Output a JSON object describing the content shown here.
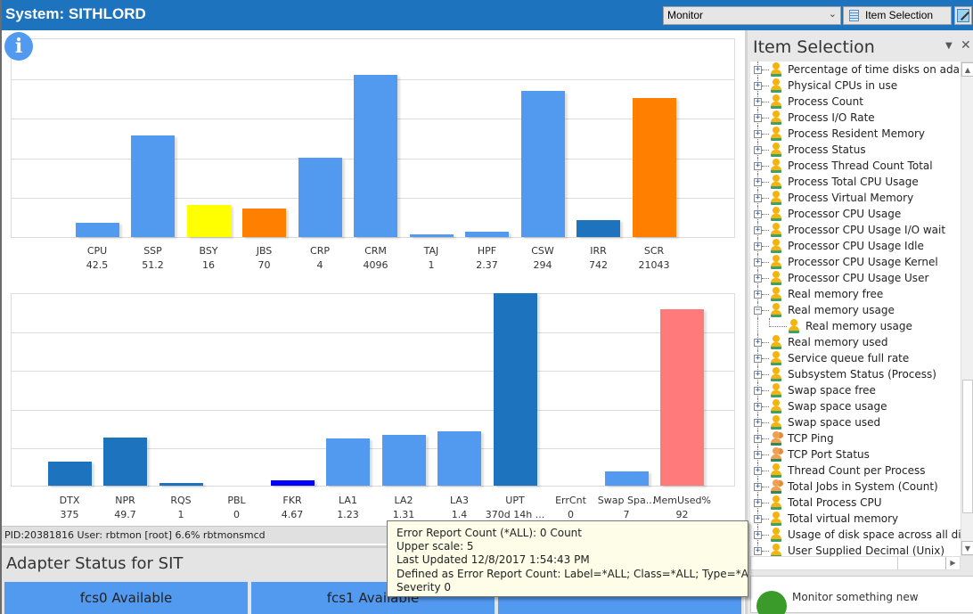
{
  "window": {
    "title": "System: SITHLORD",
    "monitor_select": "Monitor",
    "item_selection_button": "Item Selection"
  },
  "colors": {
    "titlebar": "#1e73be",
    "bar_light_blue": "#5299f0",
    "bar_dark_blue": "#1e73be",
    "bar_yellow": "#ffff00",
    "bar_orange": "#ff8000",
    "bar_blue": "#0000ff",
    "bar_salmon": "#ff7b7b"
  },
  "chart_data": [
    {
      "type": "bar",
      "title": "",
      "ylim": [
        0,
        1
      ],
      "grid": true,
      "categories": [
        "CPU",
        "SSP",
        "BSY",
        "JBS",
        "CRP",
        "CRM",
        "TAJ",
        "HPF",
        "CSW",
        "IRR",
        "SCR"
      ],
      "value_labels": [
        "42.5",
        "51.2",
        "16",
        "70",
        "4",
        "4096",
        "1",
        "2.37",
        "294",
        "742",
        "21043"
      ],
      "values_fraction_of_scale": [
        0.072,
        0.511,
        0.161,
        0.143,
        0.4,
        0.816,
        0.013,
        0.027,
        0.735,
        0.085,
        0.7
      ],
      "bar_colors": [
        "#5299f0",
        "#5299f0",
        "#ffff00",
        "#ff8000",
        "#5299f0",
        "#5299f0",
        "#5299f0",
        "#5299f0",
        "#5299f0",
        "#1e73be",
        "#ff8000"
      ]
    },
    {
      "type": "bar",
      "title": "",
      "ylim": [
        0,
        1
      ],
      "grid": true,
      "categories": [
        "DTX",
        "NPR",
        "RQS",
        "PBL",
        "FKR",
        "LA1",
        "LA2",
        "LA3",
        "UPT",
        "ErrCnt",
        "Swap Spa...",
        "MemUsed%"
      ],
      "value_labels": [
        "375",
        "49.7",
        "1",
        "0",
        "4.67",
        "1.23",
        "1.31",
        "1.4",
        "370d 14h ...",
        "0",
        "7",
        "92"
      ],
      "values_fraction_of_scale": [
        0.125,
        0.25,
        0.014,
        0.0,
        0.028,
        0.245,
        0.264,
        0.282,
        1.0,
        0.0,
        0.074,
        0.917
      ],
      "bar_colors": [
        "#1e73be",
        "#1e73be",
        "#1e73be",
        "#1e73be",
        "#0000ff",
        "#5299f0",
        "#5299f0",
        "#5299f0",
        "#1e73be",
        "#1e73be",
        "#5299f0",
        "#ff7b7b"
      ]
    }
  ],
  "status_line": "PID:20381816 User: rbtmon [root] 6.6% rbtmonsmcd",
  "adapter": {
    "title": "Adapter Status for SIT",
    "tiles": [
      "fcs0 Available",
      "fcs1 Available",
      ""
    ]
  },
  "tooltip": {
    "lines": [
      "Error Report Count (*ALL): 0 Count",
      "Upper scale: 5",
      "Last Updated 12/8/2017 1:54:43 PM",
      "Defined as Error Report Count: Label=*ALL; Class=*ALL; Type=*ALL; Resource Name=*ALL",
      "Severity 0"
    ]
  },
  "side_panel": {
    "title": "Item Selection",
    "items": [
      {
        "label": "Percentage of time disks on adapter",
        "icon": "user-icon"
      },
      {
        "label": "Physical CPUs in use",
        "icon": "user-icon"
      },
      {
        "label": "Process Count",
        "icon": "user-icon"
      },
      {
        "label": "Process I/O Rate",
        "icon": "user-icon"
      },
      {
        "label": "Process Resident Memory",
        "icon": "user-icon"
      },
      {
        "label": "Process Status",
        "icon": "user-icon"
      },
      {
        "label": "Process Thread Count Total",
        "icon": "user-icon"
      },
      {
        "label": "Process Total CPU Usage",
        "icon": "user-icon"
      },
      {
        "label": "Process Virtual Memory",
        "icon": "user-icon"
      },
      {
        "label": "Processor CPU Usage",
        "icon": "user-icon"
      },
      {
        "label": "Processor CPU Usage I/O wait",
        "icon": "user-icon"
      },
      {
        "label": "Processor CPU Usage Idle",
        "icon": "user-icon"
      },
      {
        "label": "Processor CPU Usage Kernel",
        "icon": "user-icon"
      },
      {
        "label": "Processor CPU Usage User",
        "icon": "user-icon"
      },
      {
        "label": "Real memory free",
        "icon": "user-icon"
      },
      {
        "label": "Real memory usage",
        "icon": "user-icon",
        "expanded": true
      },
      {
        "label": "Real memory usage",
        "icon": "user-icon",
        "child": true
      },
      {
        "label": "Real memory used",
        "icon": "user-icon"
      },
      {
        "label": "Service queue full rate",
        "icon": "user-icon"
      },
      {
        "label": "Subsystem Status (Process)",
        "icon": "user-icon"
      },
      {
        "label": "Swap space free",
        "icon": "user-icon"
      },
      {
        "label": "Swap space usage",
        "icon": "user-icon"
      },
      {
        "label": "Swap space used",
        "icon": "user-icon"
      },
      {
        "label": "TCP Ping",
        "icon": "users-icon"
      },
      {
        "label": "TCP Port Status",
        "icon": "users-icon"
      },
      {
        "label": "Thread Count per Process",
        "icon": "user-icon"
      },
      {
        "label": "Total Jobs in System (Count)",
        "icon": "users-icon"
      },
      {
        "label": "Total Process CPU",
        "icon": "user-icon"
      },
      {
        "label": "Total virtual memory",
        "icon": "user-icon"
      },
      {
        "label": "Usage of disk space across all disks o",
        "icon": "user-icon"
      },
      {
        "label": "User Supplied Decimal (Unix)",
        "icon": "user-icon"
      }
    ],
    "new_monitor_label": "Monitor something new"
  }
}
